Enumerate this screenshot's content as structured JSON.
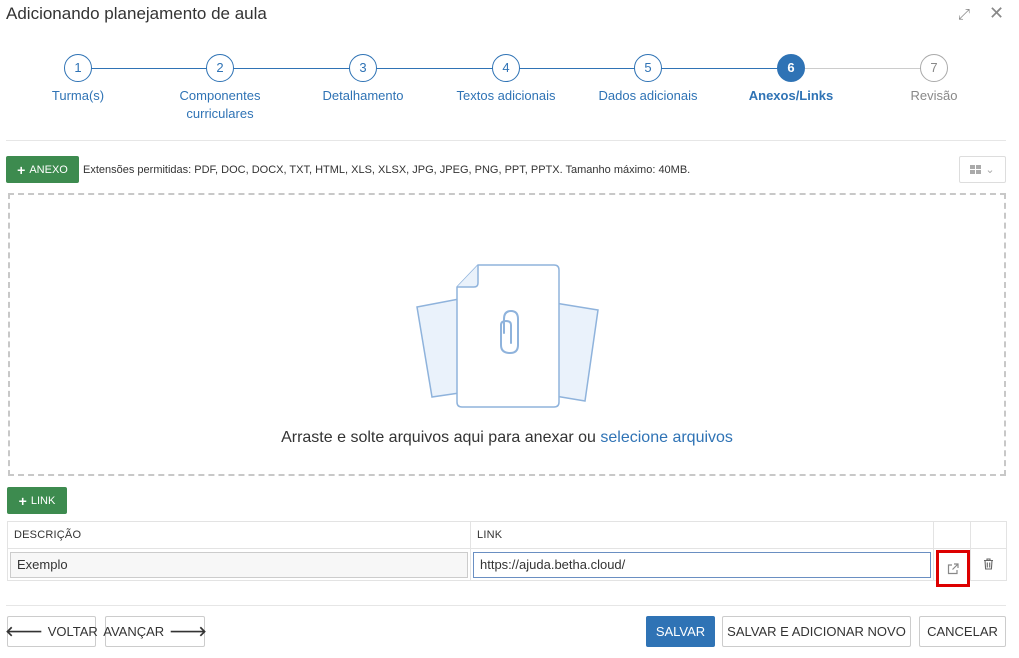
{
  "header": {
    "title": "Adicionando planejamento de aula",
    "expand_icon": "expand-icon",
    "close_icon": "close-icon"
  },
  "stepper": {
    "steps": [
      {
        "number": "1",
        "label": "Turma(s)",
        "label2": "",
        "state": "done"
      },
      {
        "number": "2",
        "label": "Componentes",
        "label2": "curriculares",
        "state": "done"
      },
      {
        "number": "3",
        "label": "Detalhamento",
        "label2": "",
        "state": "done"
      },
      {
        "number": "4",
        "label": "Textos adicionais",
        "label2": "",
        "state": "done"
      },
      {
        "number": "5",
        "label": "Dados adicionais",
        "label2": "",
        "state": "done"
      },
      {
        "number": "6",
        "label": "Anexos/Links",
        "label2": "",
        "state": "active"
      },
      {
        "number": "7",
        "label": "Revisão",
        "label2": "",
        "state": "future"
      }
    ]
  },
  "attachments": {
    "add_button_label": "ANEXO",
    "extensions_note": "Extensões permitidas: PDF, DOC, DOCX, TXT, HTML, XLS, XLSX, JPG, JPEG, PNG, PPT, PPTX. Tamanho máximo: 40MB.",
    "dropzone_text": "Arraste e solte arquivos aqui para anexar ou",
    "dropzone_link": "selecione arquivos"
  },
  "links": {
    "add_button_label": "LINK",
    "columns": [
      "DESCRIÇÃO",
      "LINK"
    ],
    "rows": [
      {
        "description": "Exemplo",
        "link": "https://ajuda.betha.cloud/"
      }
    ]
  },
  "footer": {
    "back_label": "VOLTAR",
    "next_label": "AVANÇAR",
    "save_label": "SALVAR",
    "save_new_label": "SALVAR E ADICIONAR NOVO",
    "cancel_label": "CANCELAR"
  },
  "colors": {
    "primary": "#2f73b5",
    "success": "#3d8b4f",
    "highlight": "#dd0000"
  }
}
